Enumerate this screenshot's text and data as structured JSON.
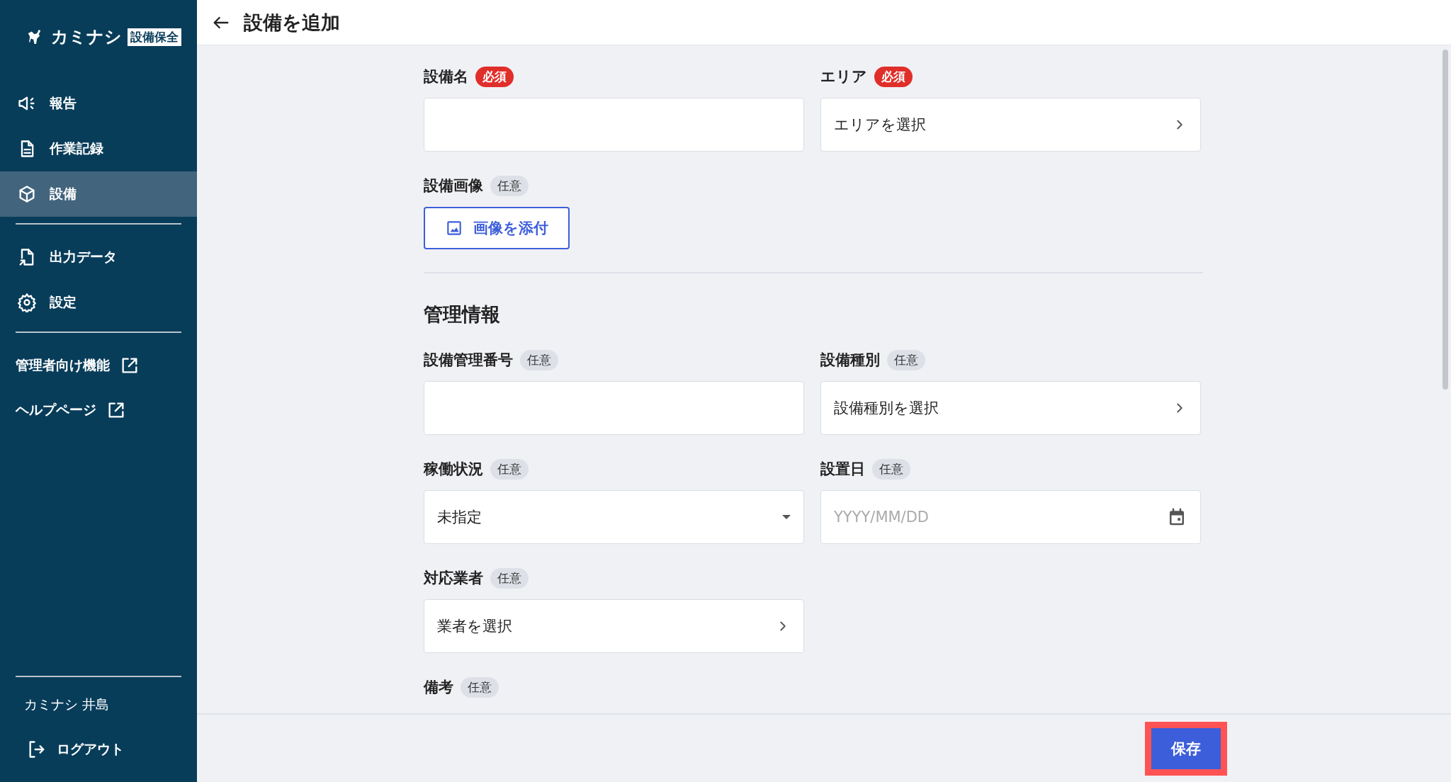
{
  "sidebar": {
    "logo": {
      "text": "カミナシ",
      "badge": "設備保全"
    },
    "nav_groups": [
      [
        {
          "label": "報告",
          "kind": "megaphone",
          "selected": false
        },
        {
          "label": "作業記録",
          "kind": "document",
          "selected": false
        },
        {
          "label": "設備",
          "kind": "cube",
          "selected": true
        }
      ],
      [
        {
          "label": "出力データ",
          "kind": "export",
          "selected": false
        },
        {
          "label": "設定",
          "kind": "gear",
          "selected": false
        }
      ]
    ],
    "external_links": [
      {
        "label": "管理者向け機能"
      },
      {
        "label": "ヘルプページ"
      }
    ],
    "user": "カミナシ 井島",
    "logout": "ログアウト"
  },
  "header": {
    "title": "設備を追加"
  },
  "form": {
    "sections": [
      {
        "rows": [
          [
            {
              "label": "設備名",
              "tag": {
                "kind": "required",
                "text": "必須"
              },
              "kind": "text"
            },
            {
              "label": "エリア",
              "tag": {
                "kind": "required",
                "text": "必須"
              },
              "kind": "picker",
              "value": "エリアを選択"
            }
          ],
          [
            {
              "label": "設備画像",
              "tag": {
                "kind": "optional",
                "text": "任意"
              },
              "kind": "image",
              "button": "画像を添付"
            }
          ]
        ]
      },
      {
        "heading": "管理情報",
        "rows": [
          [
            {
              "label": "設備管理番号",
              "tag": {
                "kind": "optional",
                "text": "任意"
              },
              "kind": "text"
            },
            {
              "label": "設備種別",
              "tag": {
                "kind": "optional",
                "text": "任意"
              },
              "kind": "picker",
              "value": "設備種別を選択"
            }
          ],
          [
            {
              "label": "稼働状況",
              "tag": {
                "kind": "optional",
                "text": "任意"
              },
              "kind": "dropdown",
              "value": "未指定"
            },
            {
              "label": "設置日",
              "tag": {
                "kind": "optional",
                "text": "任意"
              },
              "kind": "date",
              "placeholder": "YYYY/MM/DD"
            }
          ],
          [
            {
              "label": "対応業者",
              "tag": {
                "kind": "optional",
                "text": "任意"
              },
              "kind": "picker",
              "value": "業者を選択"
            }
          ],
          [
            {
              "label": "備考",
              "tag": {
                "kind": "optional",
                "text": "任意"
              },
              "kind": "none"
            }
          ]
        ]
      }
    ]
  },
  "footer": {
    "save": {
      "label": "保存",
      "highlighted": true
    }
  }
}
